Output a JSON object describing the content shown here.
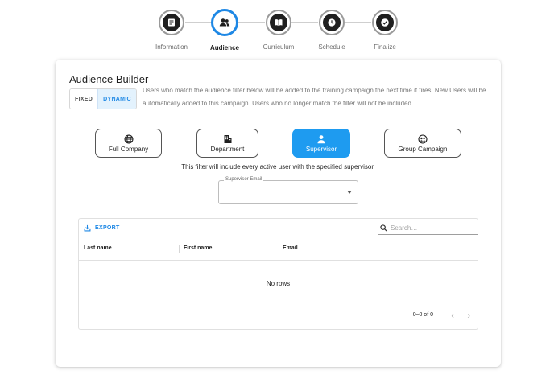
{
  "stepper": {
    "steps": [
      {
        "label": "Information",
        "icon": "document-icon"
      },
      {
        "label": "Audience",
        "icon": "people-icon"
      },
      {
        "label": "Curriculum",
        "icon": "book-icon"
      },
      {
        "label": "Schedule",
        "icon": "clock-icon"
      },
      {
        "label": "Finalize",
        "icon": "check-icon"
      }
    ],
    "active_index": 1
  },
  "audience_builder": {
    "title": "Audience Builder",
    "toggle": {
      "fixed": "FIXED",
      "dynamic": "DYNAMIC",
      "selected": "DYNAMIC"
    },
    "description": "Users who match the audience filter below will be added to the training campaign the next time it fires. New Users will be automatically added to this campaign. Users who no longer match the filter will not be included.",
    "filters": [
      {
        "label": "Full Company",
        "icon": "globe-icon"
      },
      {
        "label": "Department",
        "icon": "building-icon"
      },
      {
        "label": "Supervisor",
        "icon": "person-icon"
      },
      {
        "label": "Group Campaign",
        "icon": "group-icon"
      }
    ],
    "selected_filter": "Supervisor",
    "filter_note": "This filter will include every active user with the specified supervisor.",
    "supervisor_select": {
      "label": "Supervisor Email",
      "value": ""
    }
  },
  "grid": {
    "export_label": "EXPORT",
    "search_placeholder": "Search…",
    "columns": [
      "Last name",
      "First name",
      "Email"
    ],
    "empty_text": "No rows",
    "pagination": "0–0 of 0"
  },
  "colors": {
    "accent": "#1e88e5",
    "active_filter": "#1e9bf0"
  }
}
